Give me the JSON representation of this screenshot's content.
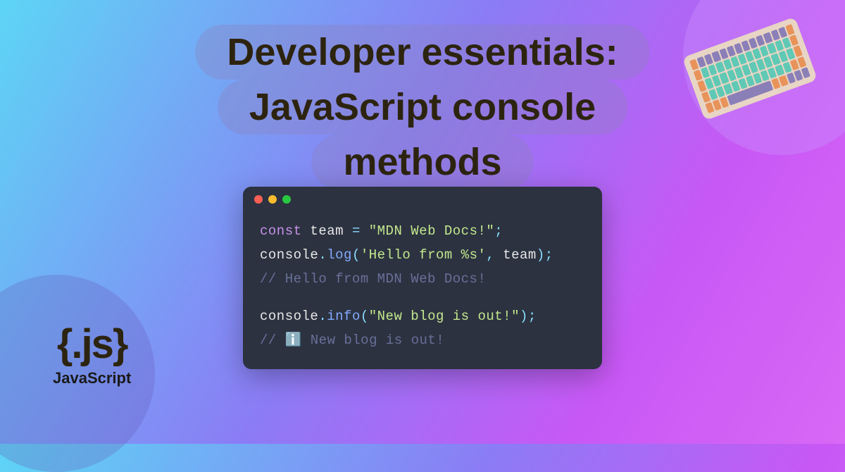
{
  "title": {
    "line1": "Developer essentials:",
    "line2": "JavaScript console",
    "line3": "methods"
  },
  "badge": {
    "logo": "{.js}",
    "label": "JavaScript"
  },
  "code": {
    "l1_kw": "const",
    "l1_var": " team ",
    "l1_eq": "= ",
    "l1_str": "\"MDN Web Docs!\"",
    "l1_end": ";",
    "l2_obj": "console",
    "l2_dot": ".",
    "l2_method": "log",
    "l2_open": "(",
    "l2_str": "'Hello from %s'",
    "l2_comma": ", ",
    "l2_arg": "team",
    "l2_close": ");",
    "l3_comment": "// Hello from MDN Web Docs!",
    "l5_obj": "console",
    "l5_dot": ".",
    "l5_method": "info",
    "l5_open": "(",
    "l5_str": "\"New blog is out!\"",
    "l5_close": ");",
    "l6_comment": "// ℹ️ New blog is out!"
  }
}
